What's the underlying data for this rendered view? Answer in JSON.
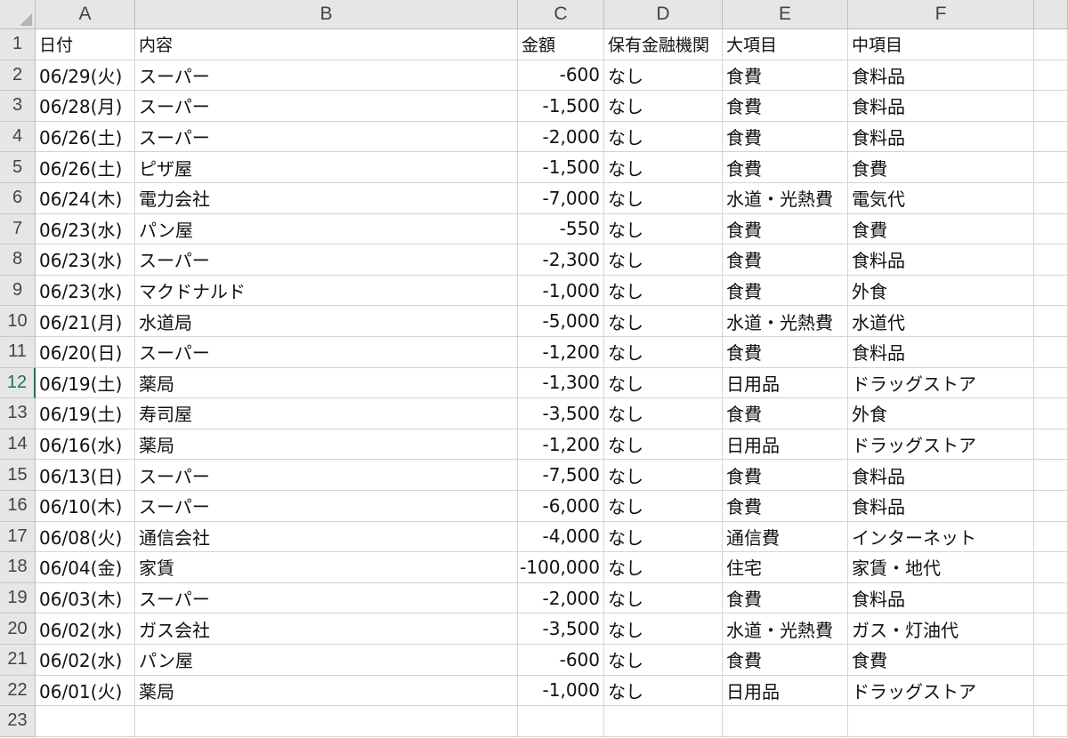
{
  "columns": [
    "A",
    "B",
    "C",
    "D",
    "E",
    "F"
  ],
  "rows": [
    [
      "日付",
      "内容",
      "金額",
      "保有金融機関",
      "大項目",
      "中項目"
    ],
    [
      "06/29(火)",
      "スーパー",
      "-600",
      "なし",
      "食費",
      "食料品"
    ],
    [
      "06/28(月)",
      "スーパー",
      "-1,500",
      "なし",
      "食費",
      "食料品"
    ],
    [
      "06/26(土)",
      "スーパー",
      "-2,000",
      "なし",
      "食費",
      "食料品"
    ],
    [
      "06/26(土)",
      "ピザ屋",
      "-1,500",
      "なし",
      "食費",
      "食費"
    ],
    [
      "06/24(木)",
      "電力会社",
      "-7,000",
      "なし",
      "水道・光熱費",
      "電気代"
    ],
    [
      "06/23(水)",
      "パン屋",
      "-550",
      "なし",
      "食費",
      "食費"
    ],
    [
      "06/23(水)",
      "スーパー",
      "-2,300",
      "なし",
      "食費",
      "食料品"
    ],
    [
      "06/23(水)",
      "マクドナルド",
      "-1,000",
      "なし",
      "食費",
      "外食"
    ],
    [
      "06/21(月)",
      "水道局",
      "-5,000",
      "なし",
      "水道・光熱費",
      "水道代"
    ],
    [
      "06/20(日)",
      "スーパー",
      "-1,200",
      "なし",
      "食費",
      "食料品"
    ],
    [
      "06/19(土)",
      "薬局",
      "-1,300",
      "なし",
      "日用品",
      "ドラッグストア"
    ],
    [
      "06/19(土)",
      "寿司屋",
      "-3,500",
      "なし",
      "食費",
      "外食"
    ],
    [
      "06/16(水)",
      "薬局",
      "-1,200",
      "なし",
      "日用品",
      "ドラッグストア"
    ],
    [
      "06/13(日)",
      "スーパー",
      "-7,500",
      "なし",
      "食費",
      "食料品"
    ],
    [
      "06/10(木)",
      "スーパー",
      "-6,000",
      "なし",
      "食費",
      "食料品"
    ],
    [
      "06/08(火)",
      "通信会社",
      "-4,000",
      "なし",
      "通信費",
      "インターネット"
    ],
    [
      "06/04(金)",
      "家賃",
      "-100,000",
      "なし",
      "住宅",
      "家賃・地代"
    ],
    [
      "06/03(木)",
      "スーパー",
      "-2,000",
      "なし",
      "食費",
      "食料品"
    ],
    [
      "06/02(水)",
      "ガス会社",
      "-3,500",
      "なし",
      "水道・光熱費",
      "ガス・灯油代"
    ],
    [
      "06/02(水)",
      "パン屋",
      "-600",
      "なし",
      "食費",
      "食費"
    ],
    [
      "06/01(火)",
      "薬局",
      "-1,000",
      "なし",
      "日用品",
      "ドラッグストア"
    ],
    [
      "",
      "",
      "",
      "",
      "",
      ""
    ]
  ],
  "active_row": 12
}
